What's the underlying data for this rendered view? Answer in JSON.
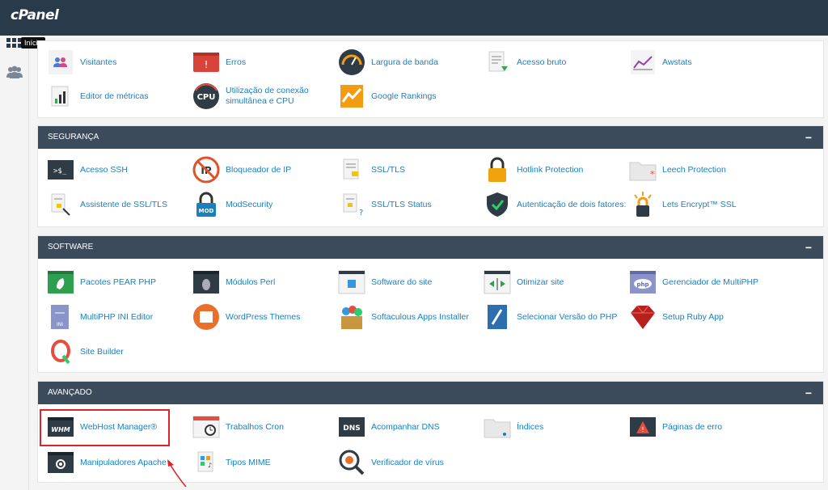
{
  "app": {
    "logo": "cPanel",
    "tooltip": "Início"
  },
  "sidebar": {
    "icons": [
      "apps-grid-icon",
      "users-icon"
    ]
  },
  "sections": {
    "metrics": {
      "items": [
        {
          "label": "Visitantes",
          "icon": "visitors-icon"
        },
        {
          "label": "Erros",
          "icon": "errors-icon"
        },
        {
          "label": "Largura de banda",
          "icon": "bandwidth-icon"
        },
        {
          "label": "Acesso bruto",
          "icon": "raw-access-icon"
        },
        {
          "label": "Awstats",
          "icon": "awstats-icon"
        },
        {
          "label": "Editor de métricas",
          "icon": "metrics-editor-icon"
        },
        {
          "label": "Utilização de conexão simultânea e CPU",
          "icon": "cpu-icon"
        },
        {
          "label": "Google Rankings",
          "icon": "rankings-icon"
        }
      ]
    },
    "security": {
      "title": "SEGURANÇA",
      "toggle": "−",
      "items": [
        {
          "label": "Acesso SSH",
          "icon": "ssh-icon"
        },
        {
          "label": "Bloqueador de IP",
          "icon": "ip-blocker-icon"
        },
        {
          "label": "SSL/TLS",
          "icon": "ssl-tls-icon"
        },
        {
          "label": "Hotlink Protection",
          "icon": "hotlink-lock-icon"
        },
        {
          "label": "Leech Protection",
          "icon": "leech-icon"
        },
        {
          "label": "Assistente de SSL/TLS",
          "icon": "ssl-wizard-icon"
        },
        {
          "label": "ModSecurity",
          "icon": "modsecurity-icon"
        },
        {
          "label": "SSL/TLS Status",
          "icon": "ssl-status-icon"
        },
        {
          "label": "Autenticação de dois fatores:",
          "icon": "two-factor-shield-icon"
        },
        {
          "label": "Lets Encrypt™ SSL",
          "icon": "letsencrypt-icon"
        }
      ]
    },
    "software": {
      "title": "SOFTWARE",
      "toggle": "−",
      "items": [
        {
          "label": "Pacotes PEAR PHP",
          "icon": "pear-icon"
        },
        {
          "label": "Módulos Perl",
          "icon": "perl-icon"
        },
        {
          "label": "Software do site",
          "icon": "site-software-icon"
        },
        {
          "label": "Otimizar site",
          "icon": "optimize-icon"
        },
        {
          "label": "Gerenciador de MultiPHP",
          "icon": "multiphp-icon"
        },
        {
          "label": "MultiPHP INI Editor",
          "icon": "ini-editor-icon"
        },
        {
          "label": "WordPress Themes",
          "icon": "wordpress-themes-icon"
        },
        {
          "label": "Softaculous Apps Installer",
          "icon": "softaculous-icon"
        },
        {
          "label": "Selecionar Versão do PHP",
          "icon": "php-version-icon"
        },
        {
          "label": "Setup Ruby App",
          "icon": "ruby-icon"
        },
        {
          "label": "Site Builder",
          "icon": "site-builder-icon"
        }
      ]
    },
    "advanced": {
      "title": "AVANÇADO",
      "toggle": "−",
      "items": [
        {
          "label": "WebHost Manager®",
          "icon": "whm-icon"
        },
        {
          "label": "Trabalhos Cron",
          "icon": "cron-icon"
        },
        {
          "label": "Acompanhar DNS",
          "icon": "dns-icon"
        },
        {
          "label": "Índices",
          "icon": "indexes-folder-icon"
        },
        {
          "label": "Páginas de erro",
          "icon": "error-pages-icon"
        },
        {
          "label": "Manipuladores Apache",
          "icon": "apache-handlers-icon"
        },
        {
          "label": "Tipos MIME",
          "icon": "mime-types-icon"
        },
        {
          "label": "Verificador de vírus",
          "icon": "virus-scanner-icon"
        }
      ]
    }
  }
}
